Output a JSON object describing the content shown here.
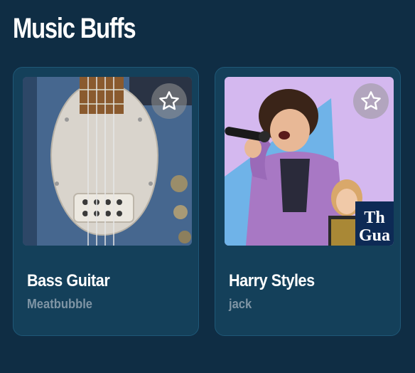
{
  "page": {
    "title": "Music Buffs"
  },
  "cards": [
    {
      "title": "Bass Guitar",
      "subtitle": "Meatbubble",
      "image_icon": "bass-guitar-photo",
      "favorite_icon": "star-outline-icon"
    },
    {
      "title": "Harry Styles",
      "subtitle": "jack",
      "image_icon": "singer-photo",
      "favorite_icon": "star-outline-icon",
      "image_overlay_text": "The Gua"
    }
  ],
  "colors": {
    "background": "#0f2d44",
    "card": "#14405a",
    "title": "#ffffff",
    "subtitle": "#7f95a5"
  }
}
